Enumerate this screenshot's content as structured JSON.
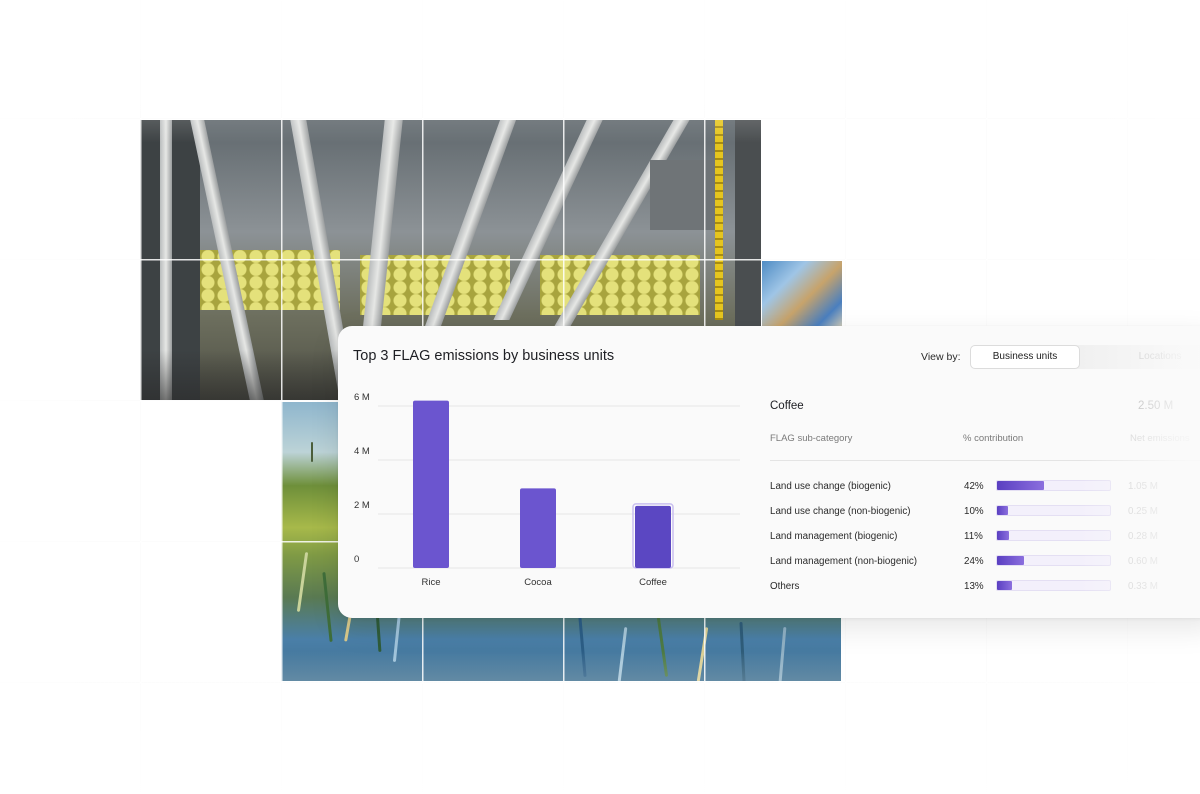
{
  "card": {
    "title": "Top 3 FLAG emissions by business units",
    "view_by_label": "View by:",
    "view_options": [
      {
        "label": "Business units",
        "active": true
      },
      {
        "label": "Locations",
        "active": false
      }
    ]
  },
  "chart_data": {
    "type": "bar",
    "categories": [
      "Rice",
      "Cocoa",
      "Coffee"
    ],
    "values": [
      6.2,
      2.95,
      2.3
    ],
    "unit": "M",
    "ylim": [
      0,
      6
    ],
    "yticks": [
      "0",
      "2 M",
      "4 M",
      "6 M"
    ],
    "ytick_values": [
      0,
      2,
      4,
      6
    ],
    "selected": "Coffee",
    "bar_color": "#6b55cf",
    "grid": true
  },
  "detail": {
    "title": "Coffee",
    "total": "2.50 M",
    "headers": {
      "category": "FLAG sub-category",
      "contribution": "% contribution",
      "net": "Net emissions"
    },
    "rows": [
      {
        "label": "Land use change (biogenic)",
        "pct": "42%",
        "share": 0.42,
        "net": "1.05 M"
      },
      {
        "label": "Land use change (non-biogenic)",
        "pct": "10%",
        "share": 0.1,
        "net": "0.25 M"
      },
      {
        "label": "Land management (biogenic)",
        "pct": "11%",
        "share": 0.11,
        "net": "0.28 M"
      },
      {
        "label": "Land management (non-biogenic)",
        "pct": "24%",
        "share": 0.24,
        "net": "0.60 M"
      },
      {
        "label": "Others",
        "pct": "13%",
        "share": 0.13,
        "net": "0.33 M"
      }
    ]
  },
  "colors": {
    "accent": "#6b55cf",
    "accent_light": "#8b6fde",
    "track": "#f3f0fb"
  }
}
